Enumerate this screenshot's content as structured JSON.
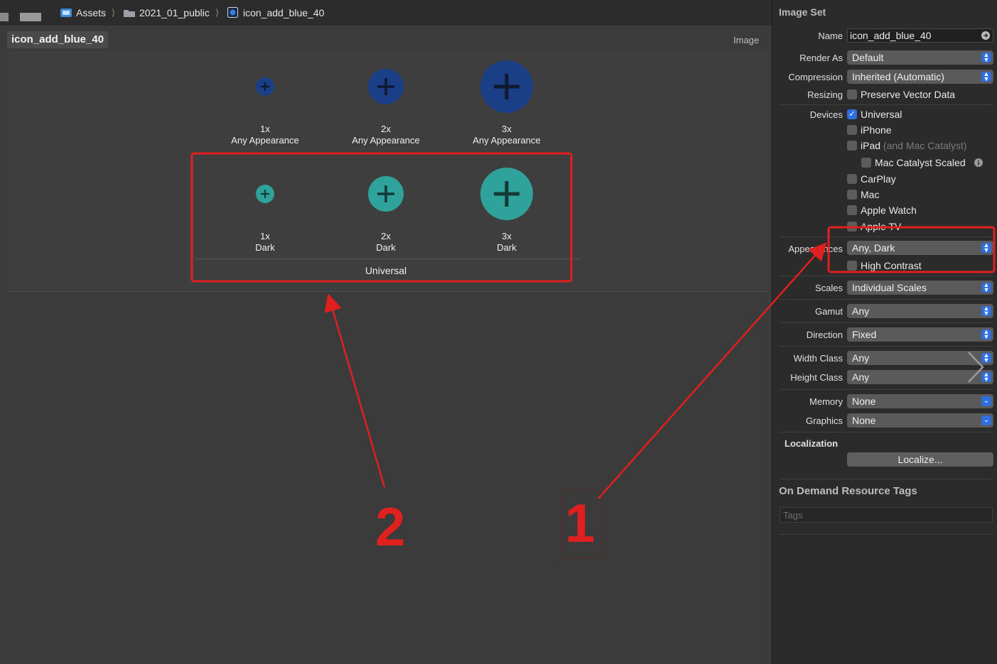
{
  "breadcrumb": {
    "items": [
      {
        "label": "Assets",
        "icon": "asset-catalog-icon"
      },
      {
        "label": "2021_01_public",
        "icon": "folder-icon"
      },
      {
        "label": "icon_add_blue_40",
        "icon": "image-set-icon"
      }
    ],
    "separator": "⟩"
  },
  "editor": {
    "set_name": "icon_add_blue_40",
    "type_tag": "Image",
    "slots": [
      {
        "scale": "1x",
        "appearance": "Any Appearance",
        "color": "#1e4fa0"
      },
      {
        "scale": "2x",
        "appearance": "Any Appearance",
        "color": "#1e4fa0"
      },
      {
        "scale": "3x",
        "appearance": "Any Appearance",
        "color": "#1e4fa0"
      },
      {
        "scale": "1x",
        "appearance": "Dark",
        "color": "#2fa39b"
      },
      {
        "scale": "2x",
        "appearance": "Dark",
        "color": "#2fa39b"
      },
      {
        "scale": "3x",
        "appearance": "Dark",
        "color": "#2fa39b"
      }
    ],
    "group_label": "Universal"
  },
  "annotations": {
    "number_1": "1",
    "number_2": "2",
    "color": "#e0201f"
  },
  "inspector": {
    "title": "Image Set",
    "name_label": "Name",
    "name_value": "icon_add_blue_40",
    "render_as_label": "Render As",
    "render_as_value": "Default",
    "compression_label": "Compression",
    "compression_value": "Inherited (Automatic)",
    "resizing_label": "Resizing",
    "resizing_option": "Preserve Vector Data",
    "devices_label": "Devices",
    "devices": {
      "universal": "Universal",
      "iphone": "iPhone",
      "ipad": "iPad",
      "ipad_note": "(and Mac Catalyst)",
      "mac_catalyst_scaled": "Mac Catalyst Scaled",
      "carplay": "CarPlay",
      "mac": "Mac",
      "apple_watch": "Apple Watch",
      "apple_tv": "Apple TV"
    },
    "appearances_label": "Appearances",
    "appearances_value": "Any, Dark",
    "high_contrast": "High Contrast",
    "scales_label": "Scales",
    "scales_value": "Individual Scales",
    "gamut_label": "Gamut",
    "gamut_value": "Any",
    "direction_label": "Direction",
    "direction_value": "Fixed",
    "width_class_label": "Width Class",
    "width_class_value": "Any",
    "height_class_label": "Height Class",
    "height_class_value": "Any",
    "memory_label": "Memory",
    "memory_value": "None",
    "graphics_label": "Graphics",
    "graphics_value": "None",
    "localization_title": "Localization",
    "localize_button": "Localize...",
    "odr_title": "On Demand Resource Tags",
    "tags_placeholder": "Tags"
  }
}
